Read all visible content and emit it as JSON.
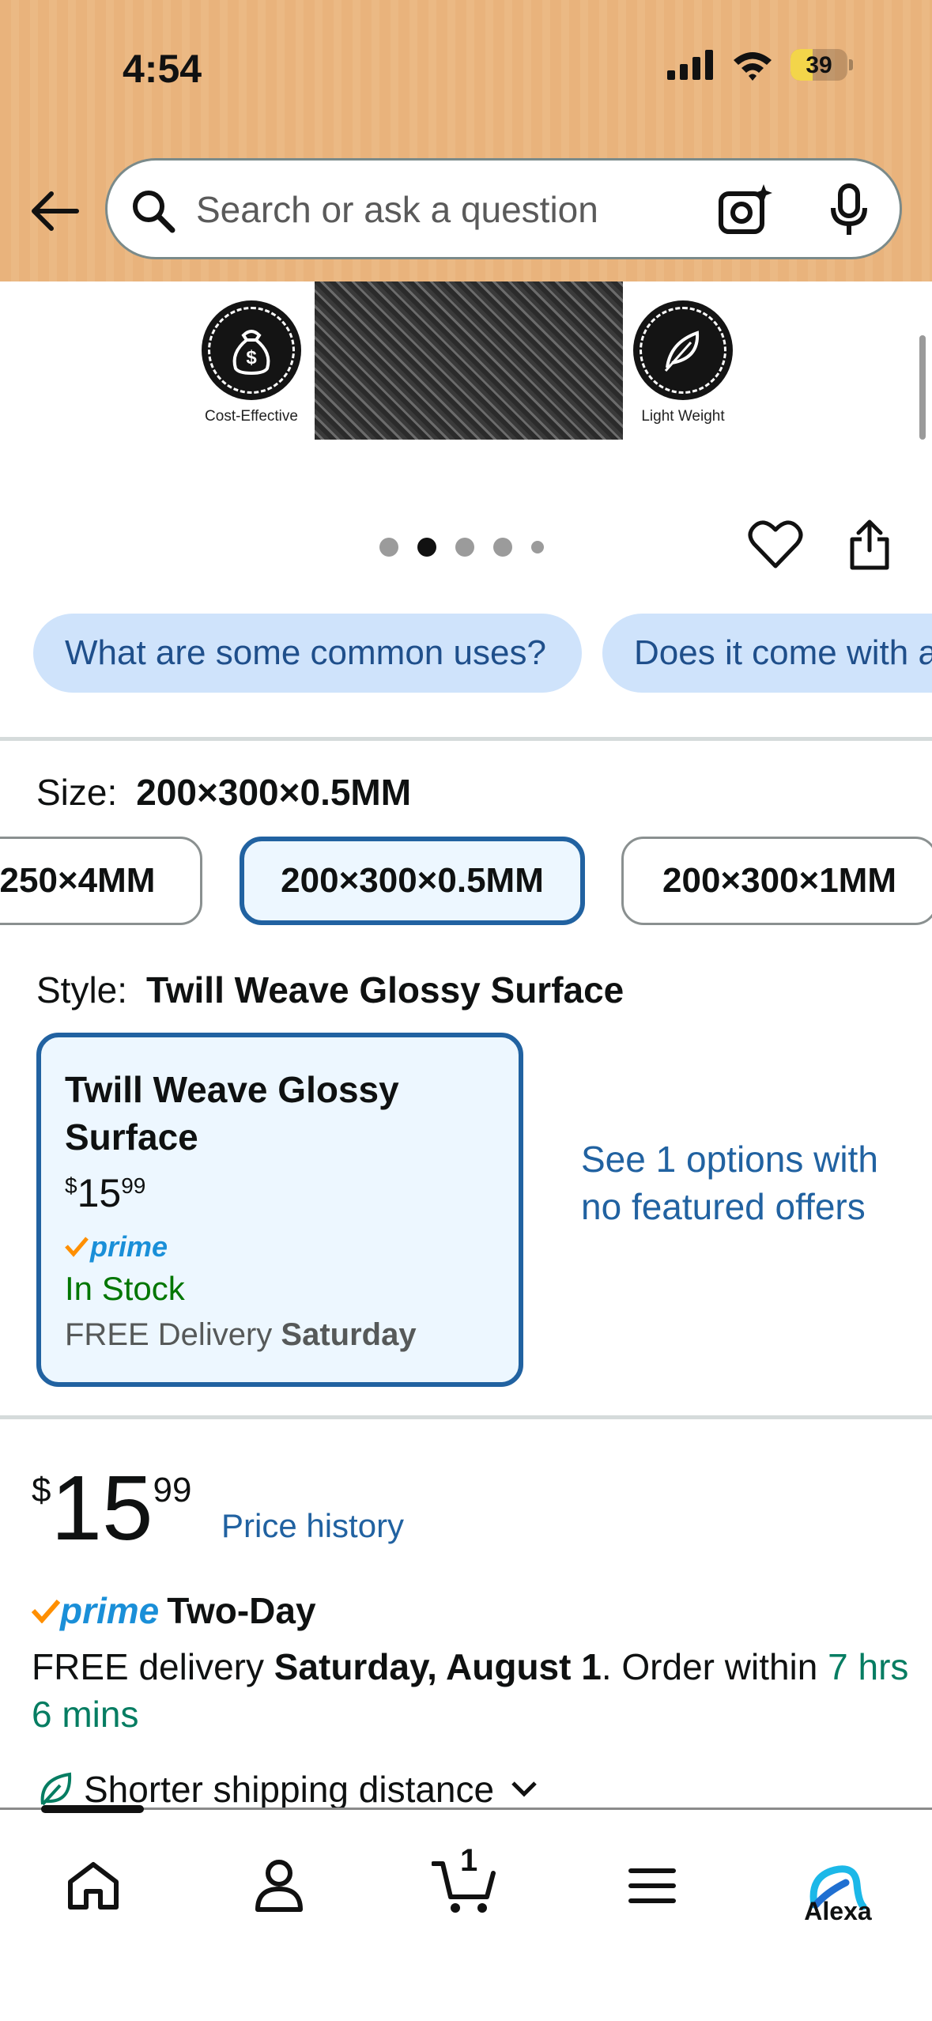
{
  "status_bar": {
    "time": "4:54",
    "battery_level": "39"
  },
  "search": {
    "placeholder": "Search or ask a question"
  },
  "product_image": {
    "feature_left": "Cost-Effective",
    "feature_right": "Light Weight",
    "image_count": 5,
    "current_image": 2
  },
  "questions": [
    "What are some common uses?",
    "Does it come with a"
  ],
  "size": {
    "label": "Size:",
    "selected": "200×300×0.5MM",
    "options": [
      "250×4MM",
      "200×300×0.5MM",
      "200×300×1MM"
    ]
  },
  "style": {
    "label": "Style:",
    "selected": "Twill Weave Glossy Surface",
    "card": {
      "name": "Twill Weave Glossy Surface",
      "price_symbol": "$",
      "price_whole": "15",
      "price_fraction": "99",
      "prime": "prime",
      "stock": "In Stock",
      "delivery_prefix": "FREE Delivery",
      "delivery_day": "Saturday"
    },
    "see_options": "See 1 options with no featured offers"
  },
  "price": {
    "symbol": "$",
    "whole": "15",
    "fraction": "99",
    "history_link": "Price history"
  },
  "shipping": {
    "prime": "prime",
    "speed": "Two-Day",
    "delivery_prefix": "FREE delivery",
    "delivery_date": "Saturday, August 1",
    "order_within_prefix": ". Order within",
    "order_within_time": "7 hrs 6 mins",
    "shorter_shipping": "Shorter shipping distance"
  },
  "bottom_nav": {
    "cart_count": "1",
    "alexa_label": "Alexa"
  },
  "colors": {
    "header_bg": "#e9b37c",
    "link_blue": "#2162a1",
    "chip_bg": "#cfe3fb",
    "in_stock_green": "#007600",
    "selected_border": "#2162a1",
    "prime_blue": "#1a8fd8",
    "prime_check": "#ff8f00"
  }
}
